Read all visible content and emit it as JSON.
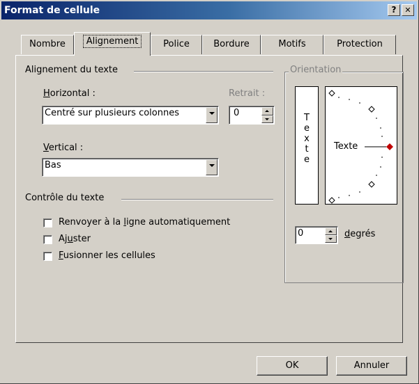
{
  "window": {
    "title": "Format de cellule",
    "help_label": "?",
    "close_label": "✕"
  },
  "tabs": [
    {
      "label": "Nombre",
      "active": false
    },
    {
      "label": "Alignement",
      "active": true
    },
    {
      "label": "Police",
      "active": false
    },
    {
      "label": "Bordure",
      "active": false
    },
    {
      "label": "Motifs",
      "active": false
    },
    {
      "label": "Protection",
      "active": false
    }
  ],
  "alignment": {
    "section_title": "Alignement du texte",
    "horizontal": {
      "label_prefix": "H",
      "label_rest": "orizontal :",
      "value": "Centré sur plusieurs colonnes"
    },
    "indent": {
      "label": "Retrait :",
      "value": "0"
    },
    "vertical": {
      "label_prefix": "V",
      "label_rest": "ertical :",
      "value": "Bas"
    }
  },
  "text_control": {
    "section_title": "Contrôle du texte",
    "wrap": {
      "before": "Renvoyer à la ",
      "accel": "l",
      "after": "igne automatiquement",
      "checked": false
    },
    "shrink": {
      "before": "Aj",
      "accel": "u",
      "after": "ster",
      "checked": false
    },
    "merge": {
      "before": "",
      "accel": "F",
      "after": "usionner les cellules",
      "checked": false
    }
  },
  "orientation": {
    "title": "Orientation",
    "vertical_letters": [
      "T",
      "e",
      "x",
      "t",
      "e"
    ],
    "dial_text": "Texte",
    "degrees_value": "0",
    "degrees_label_accel": "d",
    "degrees_label_rest": "egrés",
    "marker_color": "#c00000"
  },
  "buttons": {
    "ok": "OK",
    "cancel": "Annuler"
  }
}
